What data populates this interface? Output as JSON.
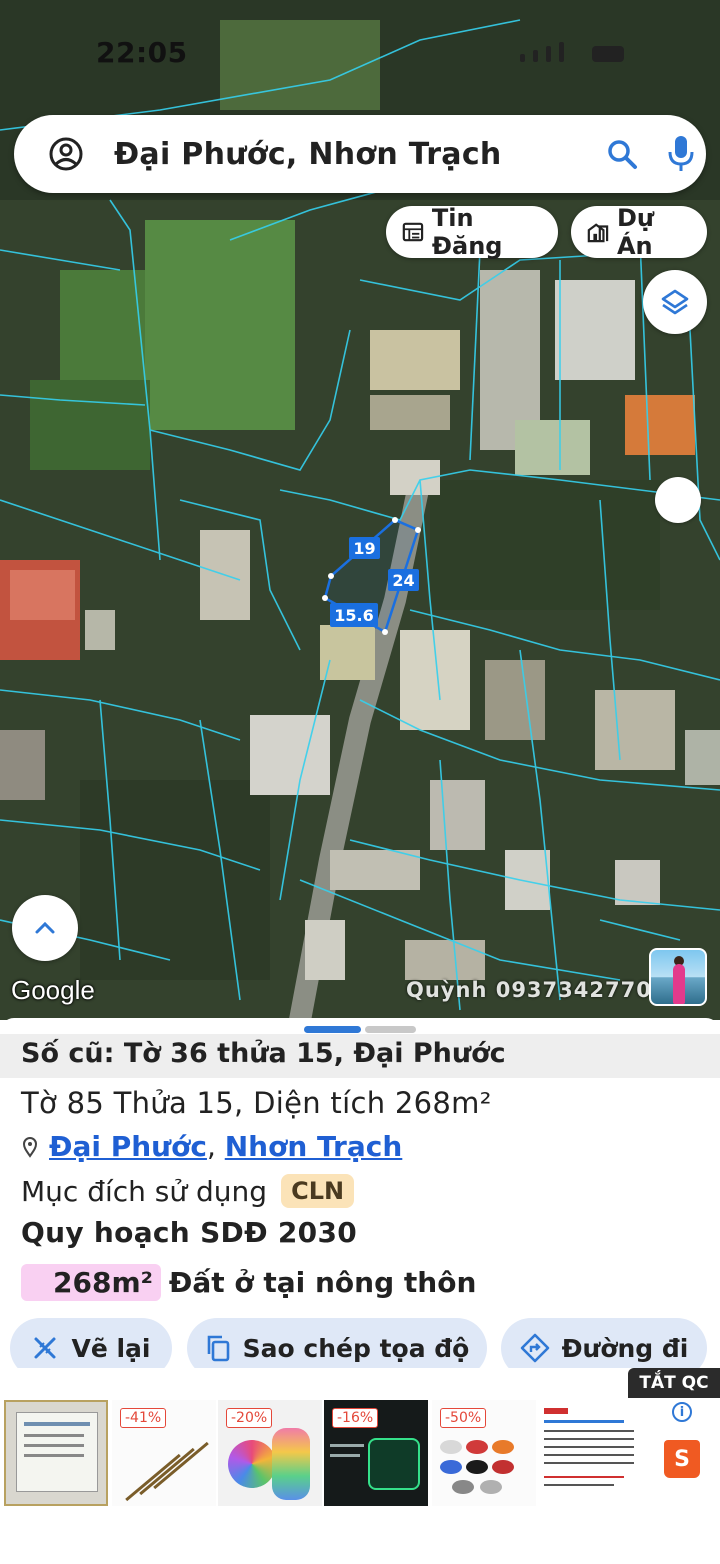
{
  "status_bar": {
    "time": "22:05"
  },
  "search": {
    "query": "Đại Phước, Nhơn Trạch"
  },
  "map_chips": {
    "listings": "Tin Đăng",
    "projects": "Dự Án"
  },
  "parcel": {
    "edge_labels": [
      "19",
      "24",
      "15.6"
    ]
  },
  "map_attribution": "Google",
  "watermark": "Quỳnh 0937342770",
  "sheet": {
    "old_id": "Số cũ: Tờ 36 thửa 15, Đại Phước",
    "details": "Tờ 85 Thửa 15, Diện tích 268m²",
    "location": {
      "ward": "Đại Phước",
      "separator": ",",
      "district": "Nhơn Trạch"
    },
    "usage_label": "Mục đích sử dụng",
    "usage_code": "CLN",
    "plan_title": "Quy hoạch SDĐ 2030",
    "zone_area": "268m²",
    "zone_name": "Đất ở tại nông thôn"
  },
  "actions": {
    "redraw": "Vẽ lại",
    "copy_coords": "Sao chép tọa độ",
    "directions": "Đường đi"
  },
  "ads": {
    "close_label": "TẮT QC",
    "discounts": [
      "-41%",
      "-20%",
      "-16%",
      "-50%"
    ],
    "shopee_letter": "S"
  },
  "colors": {
    "accent": "#2f78d6",
    "parcel_line": "#35d0ee",
    "parcel_selected": "#1a6fe0",
    "usage_badge": "#fbe3b8",
    "zone_fill": "#f9d0f2"
  }
}
